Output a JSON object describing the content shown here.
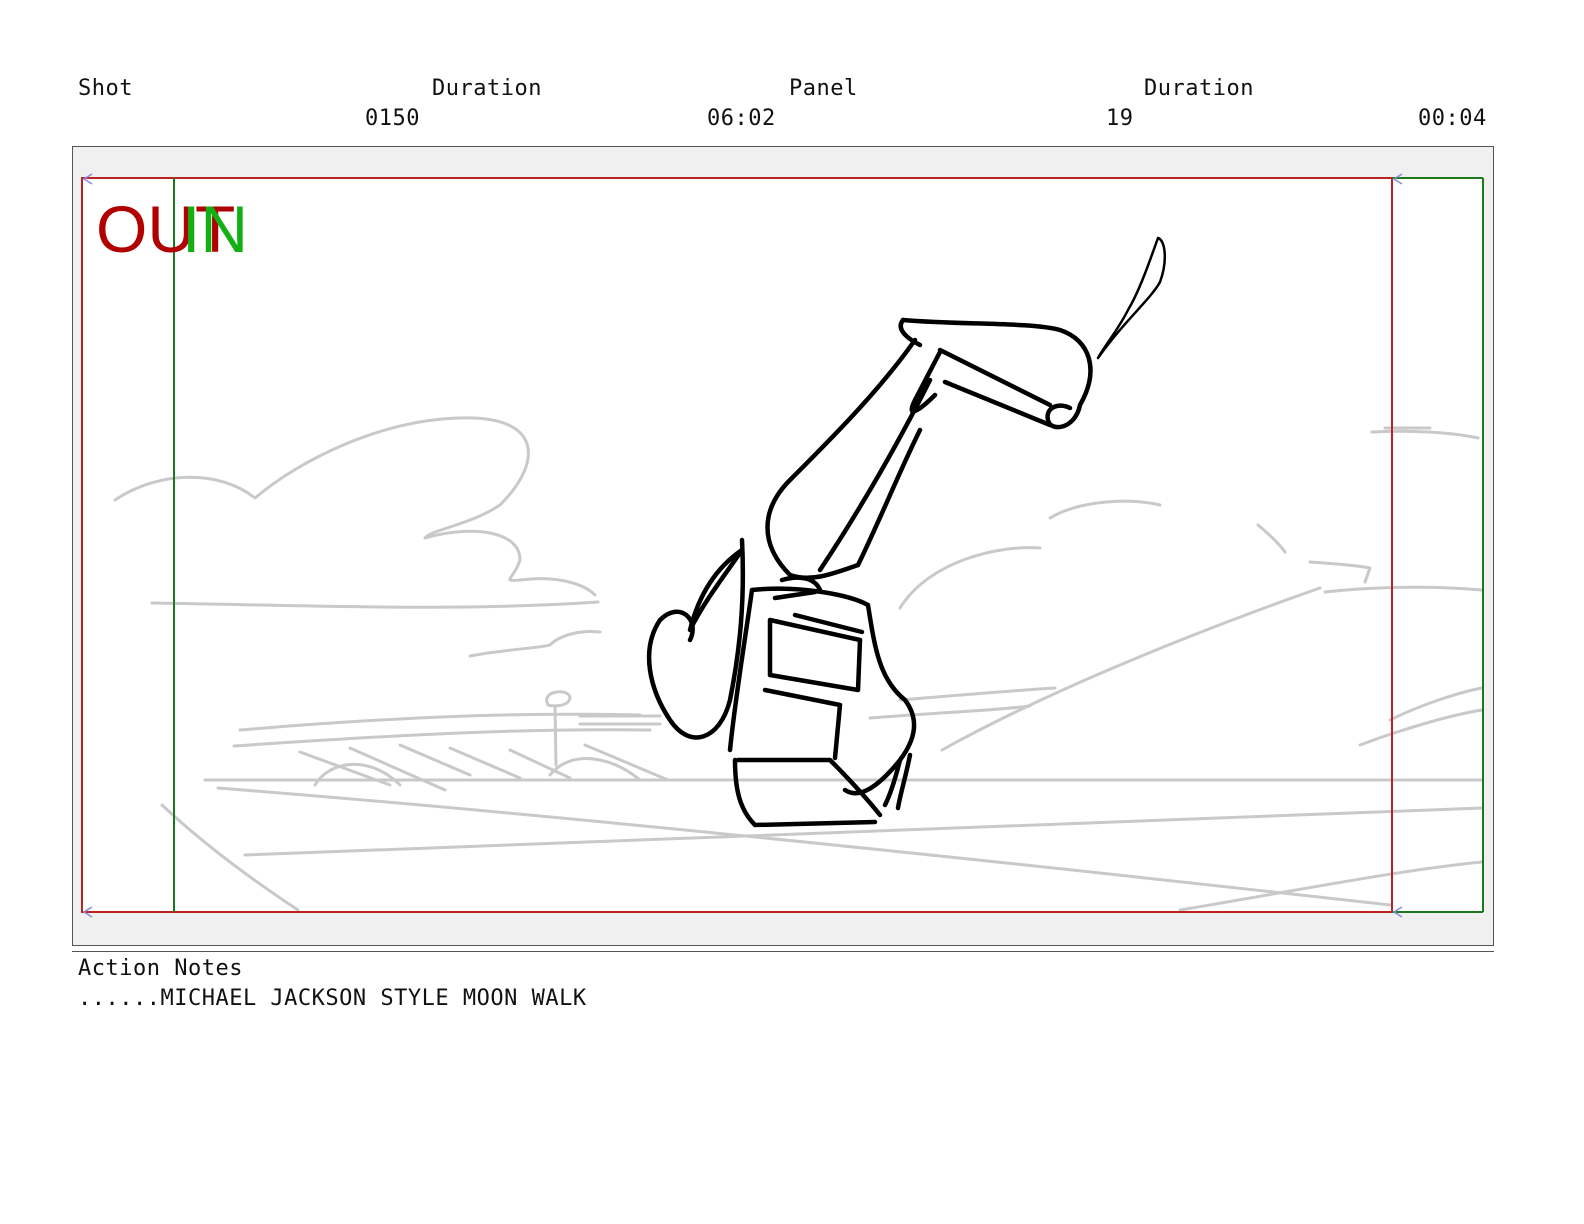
{
  "header": {
    "shot_label": "Shot",
    "shot_value": "0150",
    "shot_duration_label": "Duration",
    "shot_duration_value": "06:02",
    "panel_label": "Panel",
    "panel_value": "19",
    "panel_duration_label": "Duration",
    "panel_duration_value": "00:04"
  },
  "frame": {
    "out_label": "OUT",
    "in_label": "IN",
    "out_color": "#b00000",
    "in_color": "#12b012"
  },
  "notes": {
    "label": "Action Notes",
    "text": "......MICHAEL JACKSON STYLE MOON WALK"
  }
}
